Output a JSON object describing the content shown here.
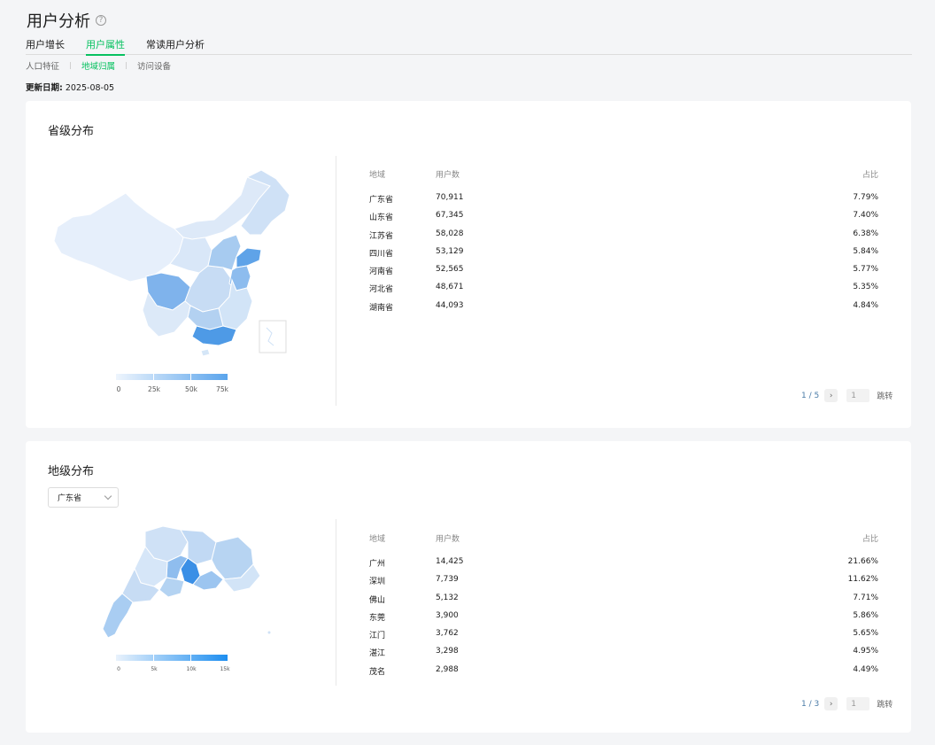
{
  "page": {
    "title": "用户分析",
    "help_icon": "?",
    "tabs": [
      {
        "label": "用户增长",
        "active": false
      },
      {
        "label": "用户属性",
        "active": true
      },
      {
        "label": "常读用户分析",
        "active": false
      }
    ],
    "subtabs": [
      {
        "label": "人口特征",
        "active": false
      },
      {
        "label": "地域归属",
        "active": true
      },
      {
        "label": "访问设备",
        "active": false
      }
    ],
    "update_label": "更新日期:",
    "update_date": "2025-08-05"
  },
  "province": {
    "title": "省级分布",
    "legend": [
      "0",
      "25k",
      "50k",
      "75k"
    ],
    "headers": {
      "region": "地域",
      "users": "用户数",
      "share": "占比"
    },
    "rows": [
      {
        "region": "广东省",
        "users": "70,911",
        "share": "7.79%"
      },
      {
        "region": "山东省",
        "users": "67,345",
        "share": "7.40%"
      },
      {
        "region": "江苏省",
        "users": "58,028",
        "share": "6.38%"
      },
      {
        "region": "四川省",
        "users": "53,129",
        "share": "5.84%"
      },
      {
        "region": "河南省",
        "users": "52,565",
        "share": "5.77%"
      },
      {
        "region": "河北省",
        "users": "48,671",
        "share": "5.35%"
      },
      {
        "region": "湖南省",
        "users": "44,093",
        "share": "4.84%"
      }
    ],
    "pager": {
      "text": "1 / 5",
      "next": "›",
      "input_value": "1",
      "jump": "跳转"
    }
  },
  "city": {
    "title": "地级分布",
    "select_value": "广东省",
    "legend": [
      "0",
      "5k",
      "10k",
      "15k"
    ],
    "headers": {
      "region": "地域",
      "users": "用户数",
      "share": "占比"
    },
    "rows": [
      {
        "region": "广州",
        "users": "14,425",
        "share": "21.66%"
      },
      {
        "region": "深圳",
        "users": "7,739",
        "share": "11.62%"
      },
      {
        "region": "佛山",
        "users": "5,132",
        "share": "7.71%"
      },
      {
        "region": "东莞",
        "users": "3,900",
        "share": "5.86%"
      },
      {
        "region": "江门",
        "users": "3,762",
        "share": "5.65%"
      },
      {
        "region": "湛江",
        "users": "3,298",
        "share": "4.95%"
      },
      {
        "region": "茂名",
        "users": "2,988",
        "share": "4.49%"
      }
    ],
    "pager": {
      "text": "1 / 3",
      "next": "›",
      "input_value": "1",
      "jump": "跳转"
    }
  },
  "colors": {
    "accent": "#07c160",
    "map_light": "#e3eefb",
    "map_mid": "#a9cdf2",
    "map_dark": "#3a8fe6",
    "pager_text": "#4a7ba7"
  }
}
